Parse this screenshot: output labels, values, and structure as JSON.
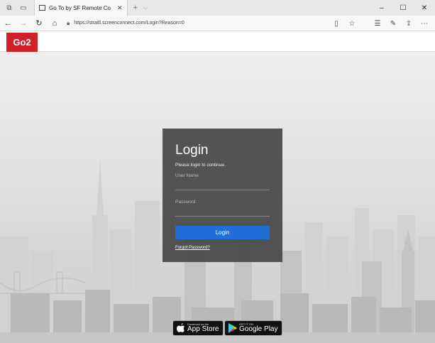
{
  "browser": {
    "tab_title": "Go To by SF Remote Co",
    "tab_close": "✕",
    "tab_new": "+",
    "tab_menu": "⌵",
    "url": "https://stratll.screenconnect.com/Login?Reason=0",
    "win_min": "–",
    "win_max": "☐",
    "win_close": "✕"
  },
  "site": {
    "logo_text": "Go2"
  },
  "login": {
    "title": "Login",
    "subtitle": "Please login to continue.",
    "username_label": "User Name",
    "password_label": "Password",
    "button_label": "Login",
    "forgot_label": "Forgot Password?"
  },
  "badges": {
    "appstore_small": "Download on the",
    "appstore_big": "App Store",
    "google_small": "GET IT ON",
    "google_big": "Google Play"
  },
  "colors": {
    "brand_red": "#d0202a",
    "login_blue": "#1f6fd6",
    "card_bg": "#484848"
  }
}
